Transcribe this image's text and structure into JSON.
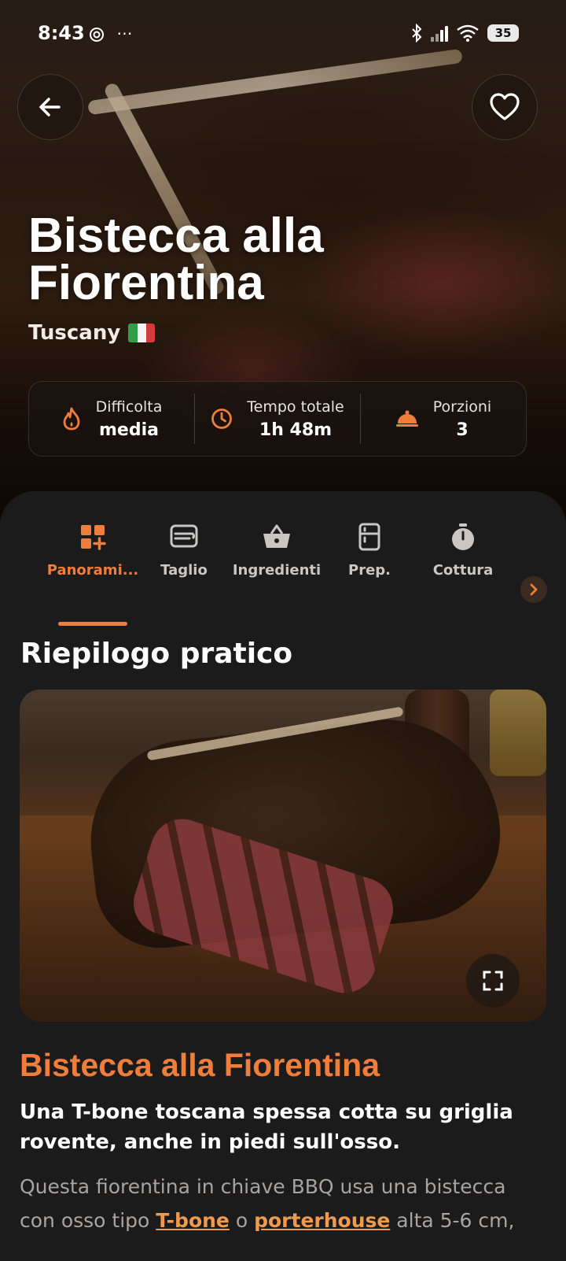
{
  "status_bar": {
    "time": "8:43",
    "extra_icons": "⋯",
    "battery": "35"
  },
  "hero": {
    "title": "Bistecca alla Fiorentina",
    "origin": "Tuscany",
    "stats": [
      {
        "icon": "flame-icon",
        "label": "Difficolta",
        "value": "media"
      },
      {
        "icon": "clock-icon",
        "label": "Tempo totale",
        "value": "1h 48m"
      },
      {
        "icon": "serving-dish-icon",
        "label": "Porzioni",
        "value": "3"
      }
    ]
  },
  "tabs": [
    {
      "label": "Panorami...",
      "icon": "grid-plus-icon",
      "active": true
    },
    {
      "label": "Taglio",
      "icon": "cutting-board-icon",
      "active": false
    },
    {
      "label": "Ingredienti",
      "icon": "basket-icon",
      "active": false
    },
    {
      "label": "Prep.",
      "icon": "fridge-icon",
      "active": false
    },
    {
      "label": "Cottura",
      "icon": "timer-icon",
      "active": false
    }
  ],
  "overview": {
    "section_title": "Riepilogo pratico",
    "recipe_title": "Bistecca alla Fiorentina",
    "subtitle": "Una T-bone toscana spessa cotta su griglia rovente, anche in piedi sull'osso.",
    "desc_part1": "Questa fiorentina in chiave BBQ usa una bistecca con osso tipo",
    "link1": "T-bone",
    "desc_part2": "o",
    "link2": "porterhouse",
    "desc_part3": "alta 5-6 cm,"
  },
  "colors": {
    "accent": "#ef7d3c",
    "background": "#1c1b1b"
  }
}
